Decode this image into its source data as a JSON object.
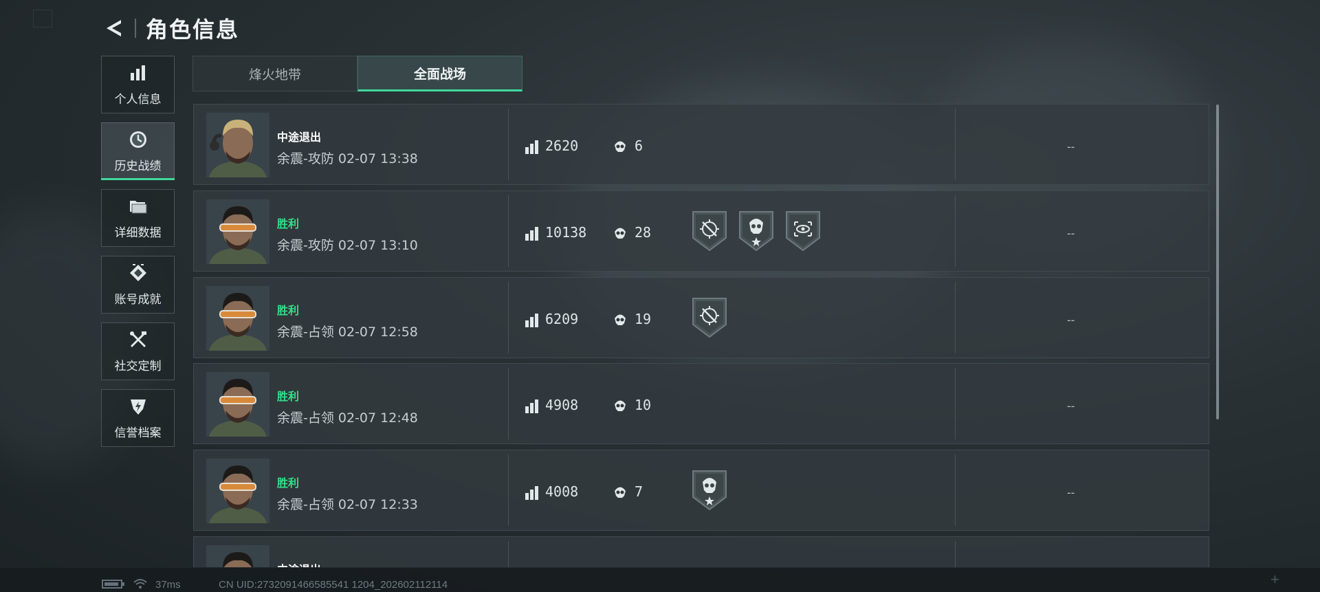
{
  "header": {
    "title": "角色信息"
  },
  "sidebar": {
    "items": [
      {
        "label": "个人信息",
        "icon": "bar-chart-icon",
        "active": false
      },
      {
        "label": "历史战绩",
        "icon": "clock-icon",
        "active": true
      },
      {
        "label": "详细数据",
        "icon": "folder-icon",
        "active": false
      },
      {
        "label": "账号成就",
        "icon": "achievement-icon",
        "active": false
      },
      {
        "label": "社交定制",
        "icon": "tools-icon",
        "active": false
      },
      {
        "label": "信誉档案",
        "icon": "shield-lightning-icon",
        "active": false
      }
    ]
  },
  "tabs": [
    {
      "label": "烽火地带",
      "active": false
    },
    {
      "label": "全面战场",
      "active": true
    }
  ],
  "matches": [
    {
      "result": "中途退出",
      "win": false,
      "mode_time": "余震-攻防 02-07 13:38",
      "score": "2620",
      "kills": "6",
      "badges": [],
      "extra": "--",
      "portrait": "blond"
    },
    {
      "result": "胜利",
      "win": true,
      "mode_time": "余震-攻防 02-07 13:10",
      "score": "10138",
      "kills": "28",
      "badges": [
        "crosshair-badge-icon",
        "skull-star-badge-icon",
        "eye-target-badge-icon"
      ],
      "extra": "--",
      "portrait": "goggles"
    },
    {
      "result": "胜利",
      "win": true,
      "mode_time": "余震-占领 02-07 12:58",
      "score": "6209",
      "kills": "19",
      "badges": [
        "crosshair-badge-icon"
      ],
      "extra": "--",
      "portrait": "goggles"
    },
    {
      "result": "胜利",
      "win": true,
      "mode_time": "余震-占领 02-07 12:48",
      "score": "4908",
      "kills": "10",
      "badges": [],
      "extra": "--",
      "portrait": "goggles"
    },
    {
      "result": "胜利",
      "win": true,
      "mode_time": "余震-占领 02-07 12:33",
      "score": "4008",
      "kills": "7",
      "badges": [
        "skull-star-badge-icon"
      ],
      "extra": "--",
      "portrait": "goggles"
    },
    {
      "result": "中途退出",
      "win": false,
      "mode_time": "",
      "score": "",
      "kills": "",
      "badges": [],
      "extra": "",
      "portrait": "goggles"
    }
  ],
  "status": {
    "ping": "37ms",
    "uid": "CN UID:2732091466585541 1204_202602112114"
  },
  "colors": {
    "accent_green": "#3fd99a",
    "win_text": "#34e089",
    "panel": "#333b3f",
    "background": "#283034"
  }
}
